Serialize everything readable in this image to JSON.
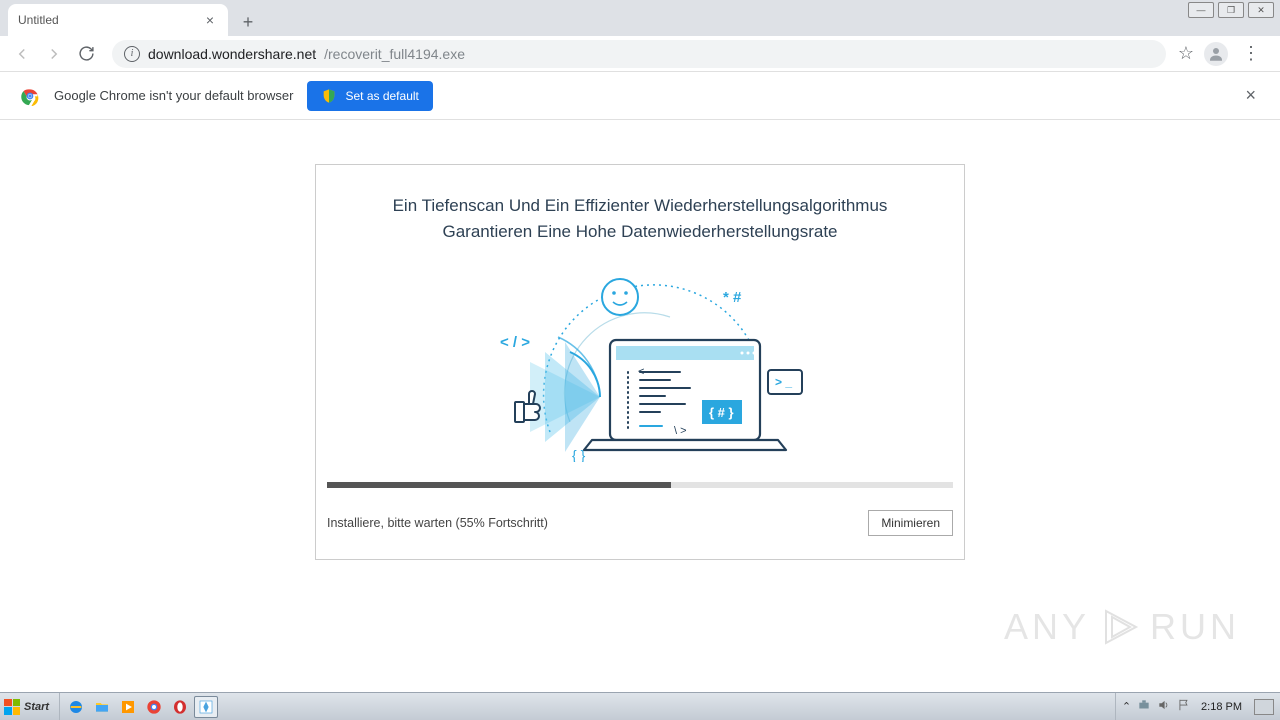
{
  "tab": {
    "title": "Untitled"
  },
  "url": {
    "host": "download.wondershare.net",
    "path": "/recoverit_full4194.exe"
  },
  "infobar": {
    "message": "Google Chrome isn't your default browser",
    "button": "Set as default"
  },
  "installer": {
    "heading": "Ein Tiefenscan Und Ein Effizienter Wiederherstellungsalgorithmus Garantieren Eine Hohe Datenwiederherstellungsrate",
    "progress_percent": 55,
    "status": "Installiere, bitte warten (55% Fortschritt)",
    "minimize": "Minimieren",
    "deco": {
      "code_tag": "< / >",
      "hash_star": "* #",
      "braces": "{  }",
      "hash_block": "{ # }",
      "prompt": "> _",
      "bracket": "<",
      "slash": "\\ >"
    }
  },
  "watermark": {
    "left": "ANY",
    "right": "RUN"
  },
  "taskbar": {
    "start": "Start",
    "clock": "2:18 PM"
  }
}
